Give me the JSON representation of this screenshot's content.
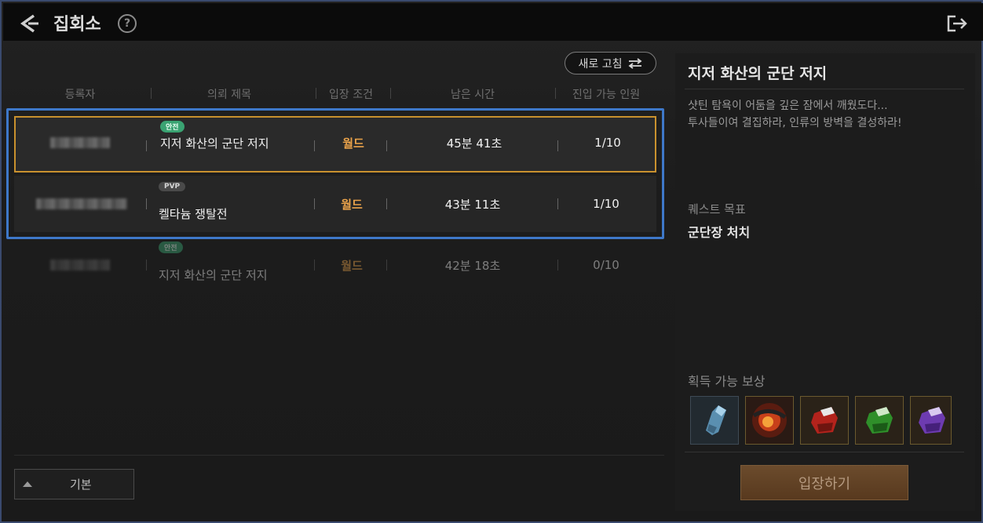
{
  "header": {
    "title": "집회소",
    "help_symbol": "?"
  },
  "toolbar": {
    "refresh_label": "새로 고침"
  },
  "table": {
    "columns": [
      "등록자",
      "의뢰 제목",
      "입장 조건",
      "남은 시간",
      "진입 가능 인원"
    ],
    "rows": [
      {
        "tag": "안전",
        "tag_type": "safe",
        "title": "지저 화산의 군단 저지",
        "condition": "월드",
        "time_left": "45분 41초",
        "count": "1/10"
      },
      {
        "tag": "PVP",
        "tag_type": "pvp",
        "title": "켈타늄 쟁탈전",
        "condition": "월드",
        "time_left": "43분 11초",
        "count": "1/10"
      },
      {
        "tag": "안전",
        "tag_type": "safe",
        "title": "지저 화산의 군단 저지",
        "condition": "월드",
        "time_left": "42분 18초",
        "count": "0/10"
      }
    ]
  },
  "filter": {
    "label": "기본"
  },
  "detail": {
    "title": "지저 화산의 군단 저지",
    "description_line1": "샷틴 탐욕이 어둠을 깊은 잠에서 깨웠도다...",
    "description_line2": "투사들이여 결집하라, 인류의 방벽을 결성하라!",
    "objective_label": "퀘스트 목표",
    "objective_value": "군단장 처치",
    "reward_label": "획득 가능 보상",
    "rewards": [
      "blue-gauntlet-icon",
      "fire-orb-icon",
      "red-gauntlet-icon",
      "green-gauntlet-icon",
      "purple-gauntlet-icon"
    ],
    "enter_label": "입장하기"
  },
  "colors": {
    "selected_border": "#c9912e",
    "focus_outline": "#3e78c9",
    "condition_text": "#e9a24a",
    "safe_tag": "#3aa372"
  }
}
